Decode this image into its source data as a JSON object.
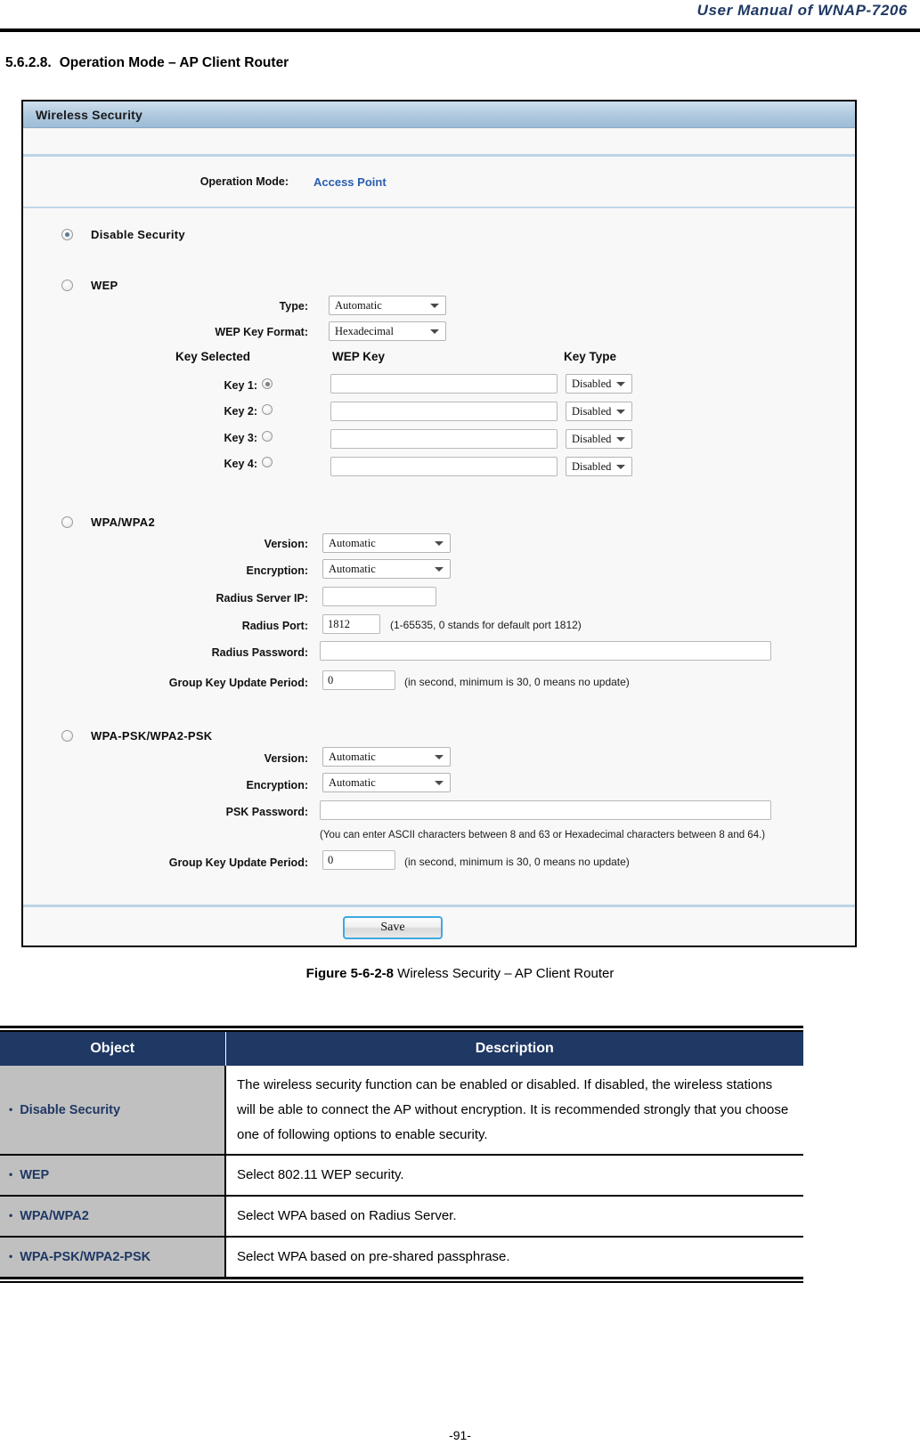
{
  "header": {
    "manual_title": "User Manual of WNAP-7206"
  },
  "section": {
    "number": "5.6.2.8.",
    "title": "Operation Mode – AP Client Router"
  },
  "panel": {
    "title": "Wireless Security",
    "operation_mode_label": "Operation Mode:",
    "operation_mode_value": "Access Point",
    "disable_security_label": "Disable Security",
    "wep": {
      "label": "WEP",
      "type_label": "Type:",
      "type_value": "Automatic",
      "key_format_label": "WEP Key Format:",
      "key_format_value": "Hexadecimal",
      "col_key_selected": "Key Selected",
      "col_wep_key": "WEP Key",
      "col_key_type": "Key Type",
      "keys": [
        {
          "name": "Key 1:",
          "value": "",
          "type": "Disabled",
          "selected": true
        },
        {
          "name": "Key 2:",
          "value": "",
          "type": "Disabled",
          "selected": false
        },
        {
          "name": "Key 3:",
          "value": "",
          "type": "Disabled",
          "selected": false
        },
        {
          "name": "Key 4:",
          "value": "",
          "type": "Disabled",
          "selected": false
        }
      ]
    },
    "wpa": {
      "label": "WPA/WPA2",
      "version_label": "Version:",
      "version_value": "Automatic",
      "encryption_label": "Encryption:",
      "encryption_value": "Automatic",
      "radius_ip_label": "Radius Server IP:",
      "radius_ip_value": "",
      "radius_port_label": "Radius Port:",
      "radius_port_value": "1812",
      "radius_port_hint": "(1-65535, 0 stands for default port 1812)",
      "radius_password_label": "Radius Password:",
      "radius_password_value": "",
      "group_key_label": "Group Key Update Period:",
      "group_key_value": "0",
      "group_key_hint": "(in second, minimum is 30, 0 means no update)"
    },
    "wpapsk": {
      "label": "WPA-PSK/WPA2-PSK",
      "version_label": "Version:",
      "version_value": "Automatic",
      "encryption_label": "Encryption:",
      "encryption_value": "Automatic",
      "psk_password_label": "PSK Password:",
      "psk_password_value": "",
      "psk_hint": "(You can enter ASCII characters between 8 and 63 or Hexadecimal characters between 8 and 64.)",
      "group_key_label": "Group Key Update Period:",
      "group_key_value": "0",
      "group_key_hint": "(in second, minimum is 30, 0 means no update)"
    },
    "save_label": "Save"
  },
  "figure": {
    "number": "Figure 5-6-2-8",
    "caption": " Wireless Security – AP Client Router"
  },
  "table": {
    "headers": {
      "object": "Object",
      "description": "Description"
    },
    "bullet": "•",
    "rows": [
      {
        "object": "Disable Security",
        "description": "The wireless security function can be enabled or disabled. If disabled, the wireless stations will be able to connect the AP without encryption. It is recommended strongly that you choose one of following options to enable security."
      },
      {
        "object": "WEP",
        "description": "Select 802.11 WEP security."
      },
      {
        "object": "WPA/WPA2",
        "description": "Select WPA based on Radius Server."
      },
      {
        "object": "WPA-PSK/WPA2-PSK",
        "description": "Select WPA based on pre-shared passphrase."
      }
    ]
  },
  "footer": {
    "page_number": "-91-"
  }
}
